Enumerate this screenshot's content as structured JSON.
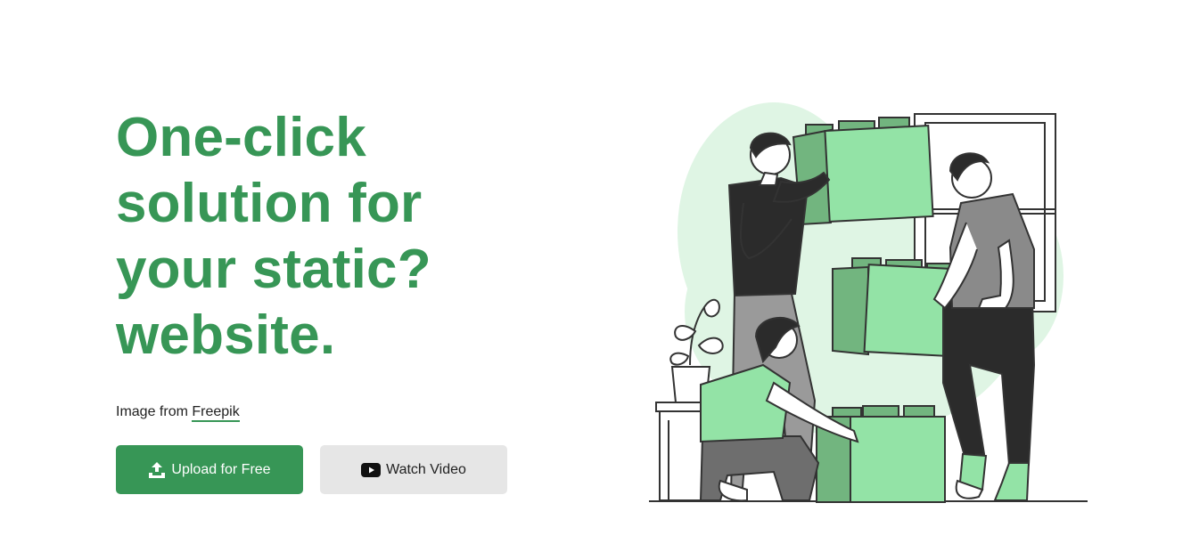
{
  "hero": {
    "headline_lines": [
      "One-click",
      "solution for",
      "your static?",
      "website."
    ],
    "credit_prefix": "Image from",
    "credit_link": "Freepik"
  },
  "buttons": {
    "upload_label": "Upload for Free",
    "watch_label": "Watch Video"
  },
  "colors": {
    "brand_green": "#379656",
    "secondary_button_bg": "#e6e6e6",
    "illustration_blob": "#dff5e4",
    "block_green": "#93e3a6",
    "block_dark_green": "#72b57f"
  },
  "icons": {
    "upload": "upload-icon",
    "video": "youtube-icon"
  }
}
